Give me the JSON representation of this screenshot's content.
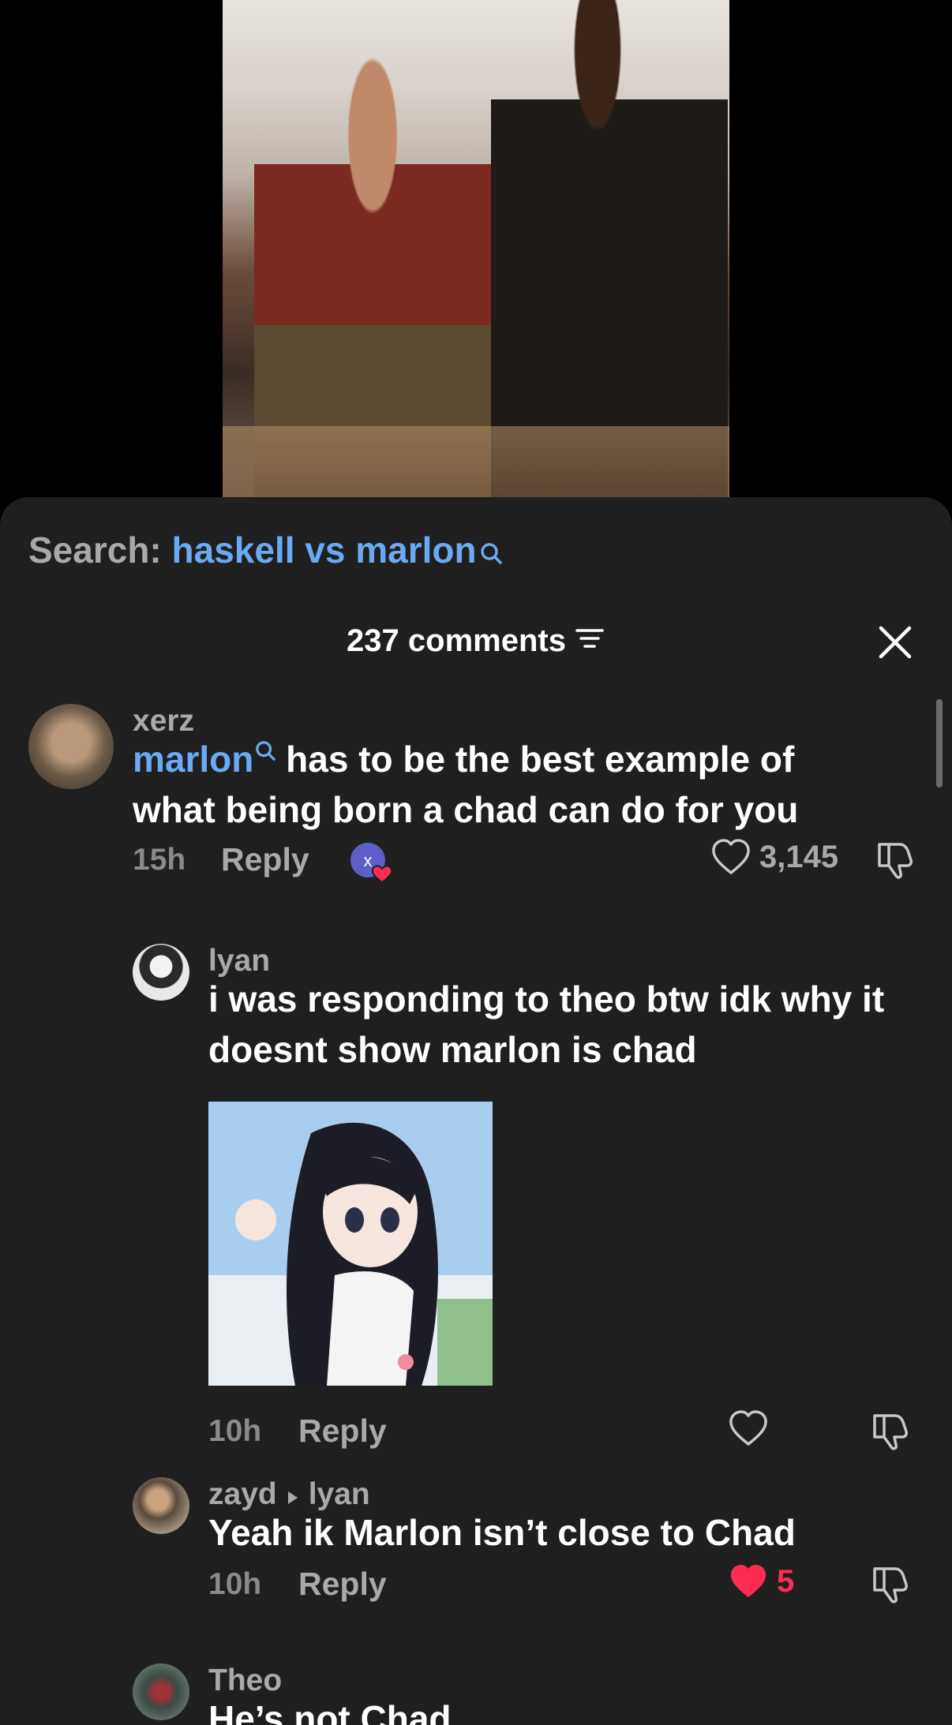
{
  "search": {
    "prefix": "Search:",
    "query": "haskell vs marlon"
  },
  "header": {
    "comments_count": "237 comments"
  },
  "comments": [
    {
      "username": "xerz",
      "mention": "marlon",
      "text": " has to be the best example of what being born a chad can do for you",
      "time": "15h",
      "reply_label": "Reply",
      "likes": "3,145",
      "creator_badge_letter": "x"
    },
    {
      "username": "lyan",
      "text": "i was responding to theo btw idk why it doesnt show marlon is chad",
      "time": "10h",
      "reply_label": "Reply"
    },
    {
      "username": "zayd",
      "reply_to": "lyan",
      "text": "Yeah ik Marlon isn’t close to Chad",
      "time": "10h",
      "reply_label": "Reply",
      "likes": "5"
    },
    {
      "username": "Theo",
      "text": "He’s not Chad"
    }
  ],
  "colors": {
    "accent_blue": "#6aa9f4",
    "like_red": "#fe2c55",
    "sheet_bg": "#1f1f1f"
  },
  "icons": {
    "search": "search-icon",
    "filter": "filter-icon",
    "close": "close-icon",
    "like": "heart-icon",
    "liked": "heart-filled-icon",
    "dislike": "thumbs-down-icon",
    "reply_arrow": "triangle-right-icon"
  }
}
